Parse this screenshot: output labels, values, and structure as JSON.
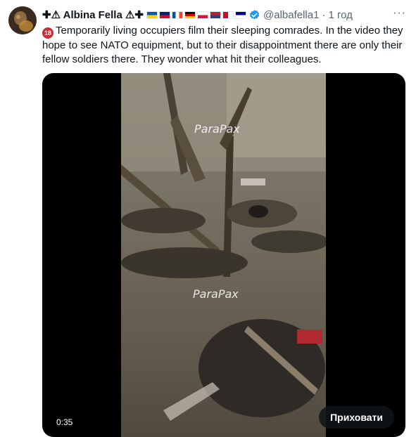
{
  "tweet": {
    "author_name": "✚⚠ Albina Fella ⚠✚",
    "flags": [
      {
        "name": "ukraine-flag",
        "colors": [
          "#0057b7",
          "#ffd700"
        ]
      },
      {
        "name": "uk-flag",
        "colors": [
          "#012169",
          "#c8102e"
        ]
      },
      {
        "name": "france-flag",
        "colors": [
          "#0055a4",
          "#ffffff",
          "#ef4135"
        ]
      },
      {
        "name": "germany-flag",
        "colors": [
          "#000000",
          "#dd0000",
          "#ffce00"
        ]
      },
      {
        "name": "poland-flag",
        "colors": [
          "#ffffff",
          "#dc143c"
        ]
      },
      {
        "name": "usa-flag",
        "colors": [
          "#b22234",
          "#3c3b6e"
        ]
      },
      {
        "name": "canada-flag",
        "colors": [
          "#d80621",
          "#ffffff"
        ]
      },
      {
        "name": "australia-flag",
        "colors": [
          "#00008b",
          "#ffffff"
        ]
      }
    ],
    "handle": "@albafella1",
    "separator": "·",
    "time": "1 год",
    "more": "···",
    "badge": "18",
    "text": "Temporarily living occupiers film their sleeping comrades. In the video they hope to see NATO equipment, but to their disappointment there are only their fellow soldiers there. They wonder what hit their colleagues."
  },
  "media": {
    "watermark_top": "ParaPax",
    "watermark_bottom": "ParaPax",
    "duration": "0:35",
    "hide_button": "Приховати"
  },
  "colors": {
    "verified": "#1d9bf0",
    "badge18": "#c62e3a",
    "secondary_text": "#536471"
  }
}
